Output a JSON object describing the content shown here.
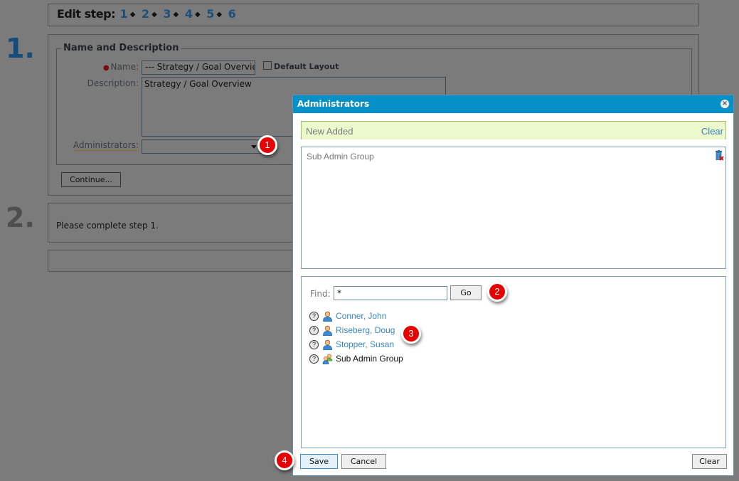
{
  "steps_bar": {
    "label": "Edit step:",
    "steps": [
      "1",
      "2",
      "3",
      "4",
      "5",
      "6"
    ],
    "separator": "◆"
  },
  "step1": {
    "number": "1.",
    "legend": "Name and Description",
    "name_label": "Name:",
    "name_value": "--- Strategy / Goal Overview",
    "default_layout_label": "Default Layout",
    "default_layout_checked": false,
    "description_label": "Description:",
    "description_value": "Strategy / Goal Overview",
    "administrators_label": "Administrators:",
    "administrators_value": "",
    "continue_label": "Continue..."
  },
  "step2": {
    "number": "2.",
    "message": "Please complete step 1."
  },
  "callouts": [
    "1",
    "2",
    "3",
    "4"
  ],
  "modal": {
    "title": "Administrators",
    "close_icon": "close-circle-icon",
    "new_added_label": "New Added",
    "new_added_clear": "Clear",
    "added_items": [
      "Sub Admin Group"
    ],
    "find_label": "Find:",
    "find_value": "*",
    "go_label": "Go",
    "results": [
      {
        "name": "Conner, John",
        "type": "user",
        "link": true
      },
      {
        "name": "Riseberg, Doug",
        "type": "user",
        "link": true
      },
      {
        "name": "Stopper, Susan",
        "type": "user",
        "link": true
      },
      {
        "name": "Sub Admin Group",
        "type": "group",
        "link": false
      }
    ],
    "save_label": "Save",
    "cancel_label": "Cancel",
    "clear_label": "Clear"
  },
  "colors": {
    "modal_header": "#0590c8",
    "new_added_bg": "#ebf9cd",
    "link": "#3b86c3",
    "callout": "#e60000",
    "overlay": "#7b7b7b"
  }
}
